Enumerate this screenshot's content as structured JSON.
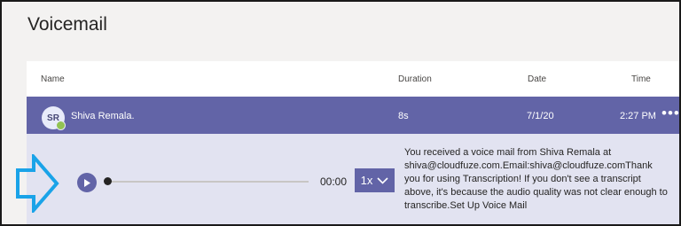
{
  "page": {
    "title": "Voicemail"
  },
  "table": {
    "headers": {
      "name": "Name",
      "duration": "Duration",
      "date": "Date",
      "time": "Time"
    },
    "selected_row": {
      "initials": "SR",
      "name": "Shiva Remala.",
      "duration": "8s",
      "date": "7/1/20",
      "time": "2:27 PM",
      "more": "•••"
    }
  },
  "player": {
    "progress": 0,
    "time_readout": "00:00",
    "speed": "1x",
    "transcript": "You received a voice mail from Shiva Remala at shiva@cloudfuze.com.Email:shiva@cloudfuze.comThank you for using Transcription! If you don't see a transcript above, it's because the audio quality was not clear enough to transcribe.Set Up Voice Mail"
  },
  "colors": {
    "accent": "#6264a7",
    "selected_row": "#6264a7",
    "expanded_bg": "#e2e3f1",
    "presence": "#92c353",
    "annotation_arrow": "#1aa3e8"
  },
  "icons": [
    "play-icon",
    "chevron-down-icon",
    "more-options-icon",
    "arrow-annotation-icon"
  ]
}
